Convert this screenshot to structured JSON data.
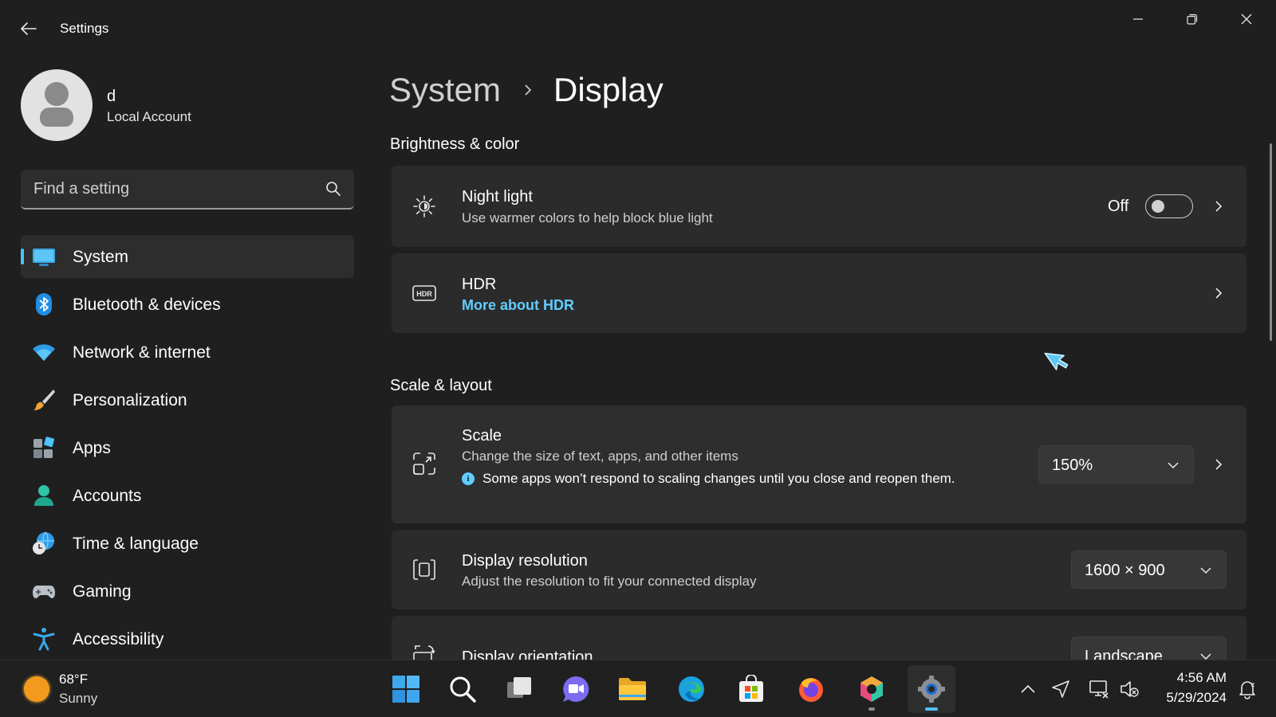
{
  "app": {
    "title": "Settings"
  },
  "profile": {
    "name": "d",
    "account_type": "Local Account"
  },
  "search": {
    "placeholder": "Find a setting"
  },
  "sidebar": {
    "items": [
      {
        "label": "System",
        "icon": "monitor-icon",
        "active": true
      },
      {
        "label": "Bluetooth & devices",
        "icon": "bluetooth-icon"
      },
      {
        "label": "Network & internet",
        "icon": "wifi-icon"
      },
      {
        "label": "Personalization",
        "icon": "paintbrush-icon"
      },
      {
        "label": "Apps",
        "icon": "apps-icon"
      },
      {
        "label": "Accounts",
        "icon": "person-icon"
      },
      {
        "label": "Time & language",
        "icon": "globe-clock-icon"
      },
      {
        "label": "Gaming",
        "icon": "gamepad-icon"
      },
      {
        "label": "Accessibility",
        "icon": "accessibility-icon"
      }
    ]
  },
  "breadcrumb": {
    "parent": "System",
    "current": "Display"
  },
  "sections": {
    "brightness": {
      "title": "Brightness & color",
      "night_light": {
        "title": "Night light",
        "subtitle": "Use warmer colors to help block blue light",
        "state_label": "Off",
        "enabled": false
      },
      "hdr": {
        "title": "HDR",
        "link": "More about HDR"
      }
    },
    "scale_layout": {
      "title": "Scale & layout",
      "scale": {
        "title": "Scale",
        "subtitle": "Change the size of text, apps, and other items",
        "info": "Some apps won’t respond to scaling changes until you close and reopen them.",
        "value": "150%"
      },
      "resolution": {
        "title": "Display resolution",
        "subtitle": "Adjust the resolution to fit your connected display",
        "value": "1600 × 900"
      },
      "orientation": {
        "title": "Display orientation",
        "value": "Landscape"
      }
    }
  },
  "taskbar": {
    "weather": {
      "temp": "68°F",
      "condition": "Sunny"
    },
    "apps": [
      "start-icon",
      "search-icon",
      "task-view-icon",
      "chat-icon",
      "file-explorer-icon",
      "edge-icon",
      "store-icon",
      "firefox-icon",
      "copilot-icon",
      "settings-icon"
    ],
    "clock": {
      "time": "4:56 AM",
      "date": "5/29/2024"
    }
  },
  "colors": {
    "accent": "#4cc2ff",
    "link": "#60cdff",
    "background": "#1f1f1f",
    "card": "#2b2b2b"
  }
}
